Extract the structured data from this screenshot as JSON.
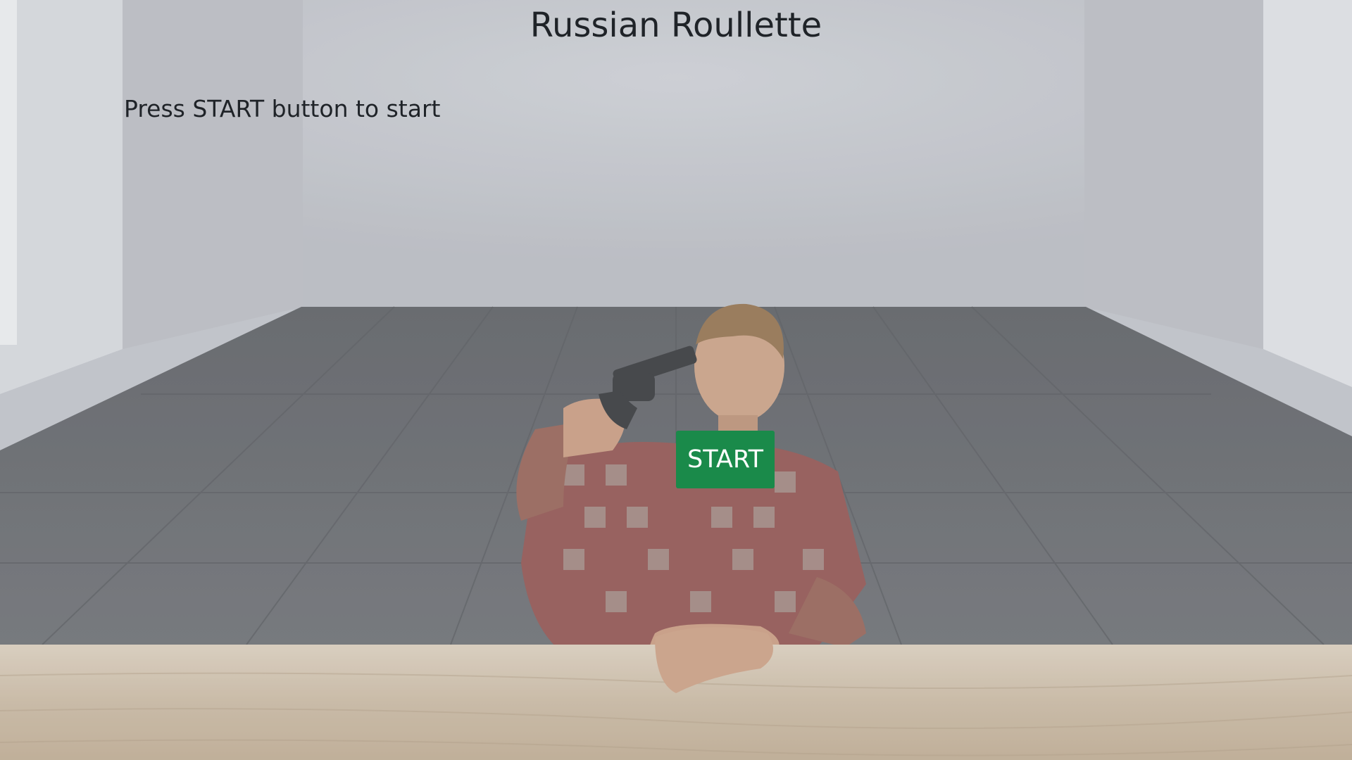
{
  "game": {
    "title": "Russian Roullette",
    "status_text": "Press START button to start",
    "start_label": "START"
  },
  "colors": {
    "wall": "#b9bcc3",
    "floor": "#5b5e63",
    "table": "#c9bba8",
    "start_button": "#1a8a4a",
    "text": "#1f2328"
  },
  "scene": {
    "character": "man in plaid shirt holding revolver to his head",
    "background": "empty room with dark wooden floor and wooden table"
  }
}
